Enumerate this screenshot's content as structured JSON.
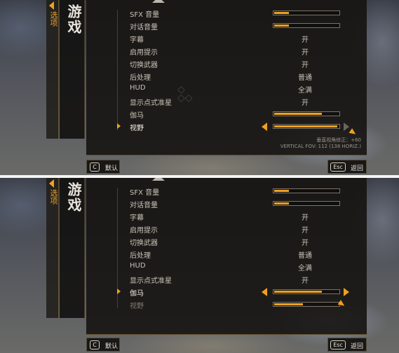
{
  "tab": {
    "label": "选项"
  },
  "section": {
    "title": "游戏"
  },
  "settings": [
    {
      "label": "SFX 音量",
      "type": "slider",
      "value": 0.22
    },
    {
      "label": "对话音量",
      "type": "slider",
      "value": 0.22
    },
    {
      "label": "字幕",
      "type": "choice",
      "value": "开"
    },
    {
      "label": "启用提示",
      "type": "choice",
      "value": "开"
    },
    {
      "label": "切换武器",
      "type": "choice",
      "value": "开"
    },
    {
      "label": "后处理",
      "type": "choice",
      "value": "普通"
    },
    {
      "label": "HUD",
      "type": "choice",
      "value": "全满"
    },
    {
      "label": "显示点式准星",
      "type": "choice",
      "value": "开"
    },
    {
      "label": "伽马",
      "type": "slider",
      "value": 0.72
    },
    {
      "label": "视野",
      "type": "slider",
      "value": 1.0,
      "value_bottom": 0.44
    }
  ],
  "fov_info": {
    "line1": "垂直视角修正：+60",
    "line2": "VERTICAL FOV: 112 (138 HORIZ.)"
  },
  "footer": {
    "default_key": "C",
    "default_label": "默认",
    "back_key": "Esc",
    "back_label": "返回"
  },
  "colors": {
    "accent": "#f0a020",
    "panel": "#161412",
    "text": "#c9c2b6"
  }
}
